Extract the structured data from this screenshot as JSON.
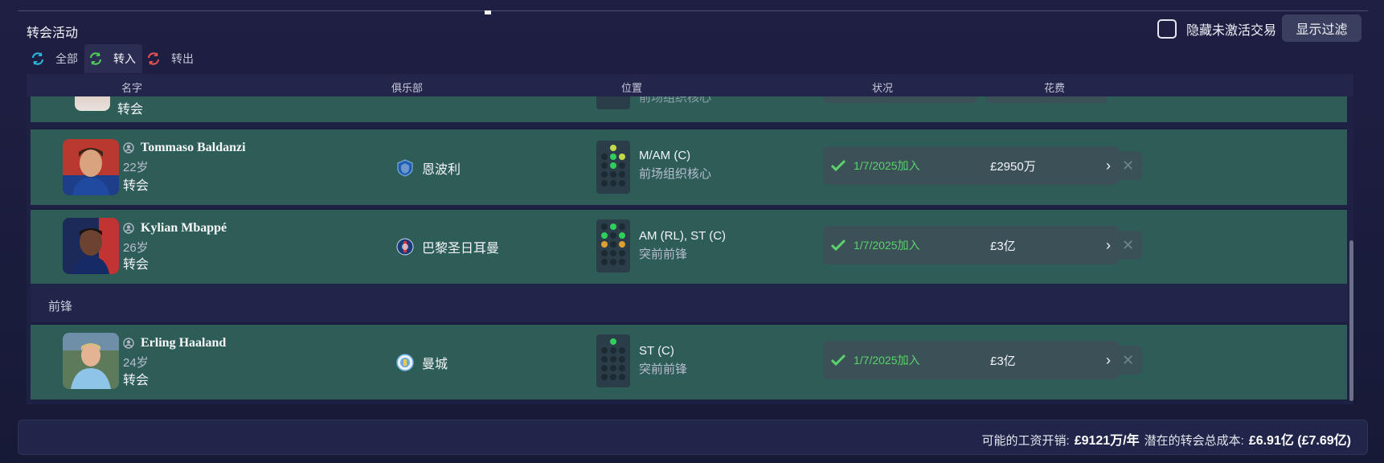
{
  "panel": {
    "title": "转会活动"
  },
  "controls": {
    "hide_inactive_label": "隐藏未激活交易",
    "filter_button": "显示过滤"
  },
  "tabs": [
    {
      "label": "全部",
      "icon": "cycle-all-icon",
      "color": "#2bb6d8"
    },
    {
      "label": "转入",
      "icon": "transfer-in-icon",
      "color": "#4fc85a",
      "active": true
    },
    {
      "label": "转出",
      "icon": "transfer-out-icon",
      "color": "#e05050"
    }
  ],
  "columns": {
    "name": "名字",
    "club": "俱乐部",
    "position": "位置",
    "status": "状况",
    "fee": "花费"
  },
  "partial_row": {
    "status": "转会",
    "role": "前场组织核心"
  },
  "section_forwards": "前锋",
  "players": [
    {
      "name": "Tommaso Baldanzi",
      "age": "22岁",
      "status": "转会",
      "club": "恩波利",
      "position": "M/AM (C)",
      "role": "前场组织核心",
      "deal": "1/7/2025加入",
      "fee": "£2950万"
    },
    {
      "name": "Kylian Mbappé",
      "age": "26岁",
      "status": "转会",
      "club": "巴黎圣日耳曼",
      "position": "AM (RL), ST (C)",
      "role": "突前前锋",
      "deal": "1/7/2025加入",
      "fee": "£3亿"
    },
    {
      "name": "Erling Haaland",
      "age": "24岁",
      "status": "转会",
      "club": "曼城",
      "position": "ST (C)",
      "role": "突前前锋",
      "deal": "1/7/2025加入",
      "fee": "£3亿"
    }
  ],
  "footer": {
    "wage_label": "可能的工资开销:",
    "wage_value": "£9121万/年",
    "cost_label": "潜在的转会总成本:",
    "cost_value": "£6.91亿 (£7.69亿)"
  },
  "colors": {
    "row_bg": "#2e5d57",
    "deal_green": "#58d46a"
  }
}
